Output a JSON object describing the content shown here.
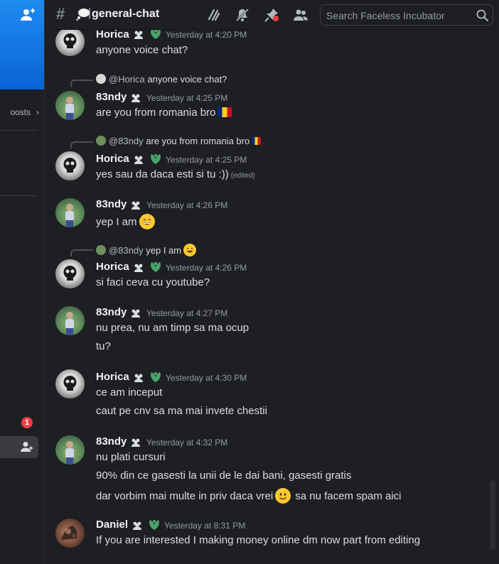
{
  "sidebar": {
    "boosts_label": "oosts",
    "badge_count": "1"
  },
  "header": {
    "channel_name": "general-chat",
    "search_placeholder": "Search Faceless Incubator"
  },
  "messages": [
    {
      "author": "Horica",
      "time": "Yesterday at 4:20 PM",
      "lines": [
        "anyone voice chat?"
      ]
    },
    {
      "reply_to": "@Horica",
      "reply_text": "anyone voice chat?",
      "author": "83ndy",
      "time": "Yesterday at 4:25 PM",
      "lines": [
        "are you from romania bro"
      ]
    },
    {
      "reply_to": "@83ndy",
      "reply_text": "are you from romania bro",
      "author": "Horica",
      "time": "Yesterday at 4:25 PM",
      "lines": [
        "yes sau da daca esti si tu :))"
      ],
      "edited": "(edited)"
    },
    {
      "author": "83ndy",
      "time": "Yesterday at 4:26 PM",
      "lines": [
        "yep I am"
      ]
    },
    {
      "reply_to": "@83ndy",
      "reply_text": "yep I am",
      "author": "Horica",
      "time": "Yesterday at 4:26 PM",
      "lines": [
        "si faci ceva cu youtube?"
      ]
    },
    {
      "author": "83ndy",
      "time": "Yesterday at 4:27 PM",
      "lines": [
        "nu prea, nu am timp sa ma ocup",
        "tu?"
      ]
    },
    {
      "author": "Horica",
      "time": "Yesterday at 4:30 PM",
      "lines": [
        "ce am inceput",
        "caut pe cnv sa ma mai invete chestii"
      ]
    },
    {
      "author": "83ndy",
      "time": "Yesterday at 4:32 PM",
      "lines": [
        "nu plati cursuri",
        "90% din ce gasesti la unii de le dai bani, gasesti gratis",
        "dar vorbim mai multe in priv daca vrei",
        "sa nu facem spam aici"
      ]
    },
    {
      "author": "Daniel",
      "time": "Yesterday at 8:31 PM",
      "lines": [
        "If you are interested I making money online dm now part from editing"
      ]
    }
  ]
}
